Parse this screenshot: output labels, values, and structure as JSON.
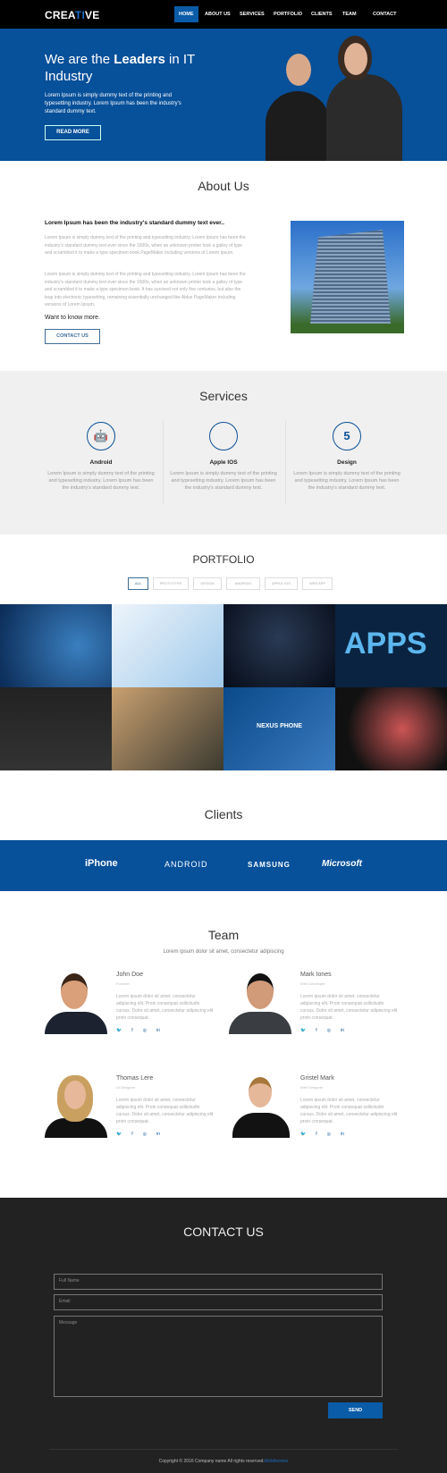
{
  "nav": {
    "logo_a": "CREA",
    "logo_b": "TI",
    "logo_c": "VE",
    "items": [
      "HOME",
      "ABOUT US",
      "SERVICES",
      "PORTFOLIO",
      "CLIENTS",
      "TEAM",
      "CONTACT"
    ],
    "active": "HOME"
  },
  "hero": {
    "title_a": "We are the ",
    "title_b": "Leaders",
    "title_c": " in IT Industry",
    "text": "Lorem Ipsum is simply dummy text of the printing and typesetting industry. Lorem Ipsum has been the industry's standard dummy text.",
    "button": "READ MORE"
  },
  "about": {
    "title": "About Us",
    "heading": "Lorem Ipsum has been the industry's standard dummy text ever..",
    "p1": "Lorem Ipsum is simply dummy text of the printing and typesetting industry. Lorem Ipsum has been the industry's standard dummy text ever since the 1500s, when an unknown printer took a galley of type and scrambled it to make a type specimen book.PageMaker including versions of Lorem Ipsum.",
    "p2": "Lorem Ipsum is simply dummy text of the printing and typesetting industry. Lorem Ipsum has been the industry's standard dummy text ever since the 1500s, when an unknown printer took a galley of type and scrambled it to make a type specimen book. It has survived not only five centuries, but also the leap into electronic typesetting, remaining essentially unchanged like Aldus PageMaker including versions of Lorem Ipsum.",
    "more": "Want to know more.",
    "button": "CONTACT US"
  },
  "services": {
    "title": "Services",
    "items": [
      {
        "icon": "android-icon",
        "name": "Android",
        "text": "Lorem Ipsum is simply dummy text of the printing and typesetting industry. Lorem Ipsum has been the industry's standard dummy text."
      },
      {
        "icon": "apple-icon",
        "name": "Apple IOS",
        "text": "Lorem Ipsum is simply dummy text of the printing and typesetting industry. Lorem Ipsum has been the industry's standard dummy text."
      },
      {
        "icon": "html5-icon",
        "name": "Design",
        "text": "Lorem Ipsum is simply dummy text of the printing and typesetting industry. Lorem Ipsum has been the industry's standard dummy text."
      }
    ]
  },
  "portfolio": {
    "title": "PORTFOLIO",
    "filters": [
      "ALL",
      "PROTOTYPE",
      "DESIGN",
      "ANDROID",
      "APPLE IOS",
      "WEB APP"
    ],
    "active": "ALL",
    "overlay": "NEXUS PHONE",
    "apps_text": "APPS"
  },
  "clients": {
    "title": "Clients",
    "logos": [
      "iPhone",
      "ANDROID",
      "SAMSUNG",
      "Microsoft"
    ]
  },
  "team": {
    "title": "Team",
    "subtitle": "Lorem ipsum dolor sit amet, consectetur adipiscing",
    "members": [
      {
        "name": "John Doe",
        "role": "Founder",
        "text": "Lorem ipsum dolor sit amet, consectetur adipiscing elit. Proin consequat sollicitudin cursus. Dolor sit amet, consectetur adipiscing elit proin consequat."
      },
      {
        "name": "Mark Iones",
        "role": "Web Developer",
        "text": "Lorem ipsum dolor sit amet, consectetur adipiscing elit. Proin consequat sollicitudin cursus. Dolor sit amet, consectetur adipiscing elit proin consequat."
      },
      {
        "name": "Thomas Lere",
        "role": "UI Designer",
        "text": "Lorem ipsum dolor sit amet, consectetur adipiscing elit. Proin consequat sollicitudin cursus. Dolor sit amet, consectetur adipiscing elit proin consequat."
      },
      {
        "name": "Gristel Mark",
        "role": "Web Designer",
        "text": "Lorem ipsum dolor sit amet, consectetur adipiscing elit. Proin consequat sollicitudin cursus. Dolor sit amet, consectetur adipiscing elit proin consequat."
      }
    ]
  },
  "contact": {
    "title": "CONTACT US",
    "name_placeholder": "Full Name",
    "email_placeholder": "Email",
    "message_placeholder": "Message",
    "button": "SEND"
  },
  "footer": {
    "copyright": "Copyright © 2016 Company name All rights reserved.",
    "link": "Webthemez"
  },
  "colors": {
    "brand": "#07509a",
    "dark": "#222222",
    "nav": "#000000"
  }
}
